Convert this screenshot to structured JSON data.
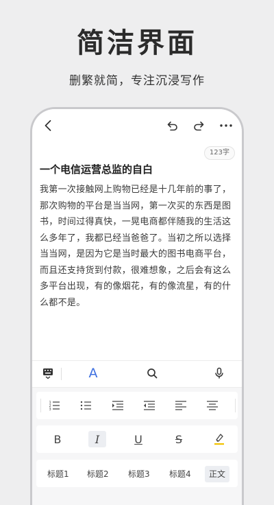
{
  "promo": {
    "title": "简洁界面",
    "subtitle": "删繁就简，专注沉浸写作"
  },
  "editor": {
    "word_count": "123字",
    "doc_title": "一个电信运营总监的自白",
    "doc_body": "我第一次接触网上购物已经是十几年前的事了，那次购物的平台是当当网，第一次买的东西是图书，时间过得真快，一晃电商都伴随我的生活这么多年了，我都已经当爸爸了。当初之所以选择当当网，是因为它是当时最大的图书电商平台，而且还支持货到付款，很难想象，之后会有这么多平台出现，有的像烟花，有的像流星，有的什么都不是。",
    "font_glyph": "A"
  },
  "style_panel": {
    "bold": "B",
    "italic": "I",
    "underline": "U",
    "strike": "S"
  },
  "heading_panel": {
    "items": [
      "标题1",
      "标题2",
      "标题3",
      "标题4",
      "正文"
    ]
  },
  "colors": {
    "accent": "#3d6fe0",
    "highlight": "#f2c200"
  }
}
